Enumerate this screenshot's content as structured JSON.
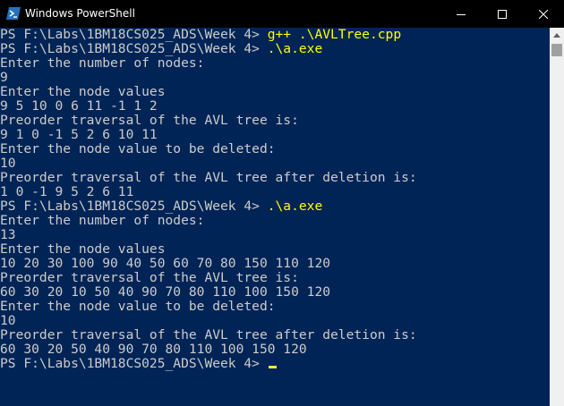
{
  "window": {
    "title": "Windows PowerShell"
  },
  "console": {
    "lines": [
      {
        "prompt": "PS F:\\Labs\\1BM18CS025_ADS\\Week 4> ",
        "cmd": "g++ .\\AVLTree.cpp"
      },
      {
        "prompt": "PS F:\\Labs\\1BM18CS025_ADS\\Week 4> ",
        "cmd": ".\\a.exe"
      },
      {
        "text": "Enter the number of nodes:"
      },
      {
        "text": "9"
      },
      {
        "text": "Enter the node values"
      },
      {
        "text": "9 5 10 0 6 11 -1 1 2"
      },
      {
        "text": "Preorder traversal of the AVL tree is:"
      },
      {
        "text": "9 1 0 -1 5 2 6 10 11"
      },
      {
        "text": "Enter the node value to be deleted:"
      },
      {
        "text": "10"
      },
      {
        "text": "Preorder traversal of the AVL tree after deletion is:"
      },
      {
        "text": "1 0 -1 9 5 2 6 11"
      },
      {
        "prompt": "PS F:\\Labs\\1BM18CS025_ADS\\Week 4> ",
        "cmd": ".\\a.exe"
      },
      {
        "text": "Enter the number of nodes:"
      },
      {
        "text": "13"
      },
      {
        "text": "Enter the node values"
      },
      {
        "text": "10 20 30 100 90 40 50 60 70 80 150 110 120"
      },
      {
        "text": "Preorder traversal of the AVL tree is:"
      },
      {
        "text": "60 30 20 10 50 40 90 70 80 110 100 150 120"
      },
      {
        "text": "Enter the node value to be deleted:"
      },
      {
        "text": "10"
      },
      {
        "text": "Preorder traversal of the AVL tree after deletion is:"
      },
      {
        "text": "60 30 20 50 40 90 70 80 110 100 150 120"
      },
      {
        "prompt": "PS F:\\Labs\\1BM18CS025_ADS\\Week 4> ",
        "cmd": "",
        "cursor": true
      }
    ]
  },
  "colors": {
    "background": "#012456",
    "text": "#cccccc",
    "command": "#ffff00",
    "titlebar": "#000000"
  },
  "icons": {
    "app": "powershell-icon",
    "minimize": "minimize-icon",
    "maximize": "maximize-icon",
    "close": "close-icon"
  }
}
